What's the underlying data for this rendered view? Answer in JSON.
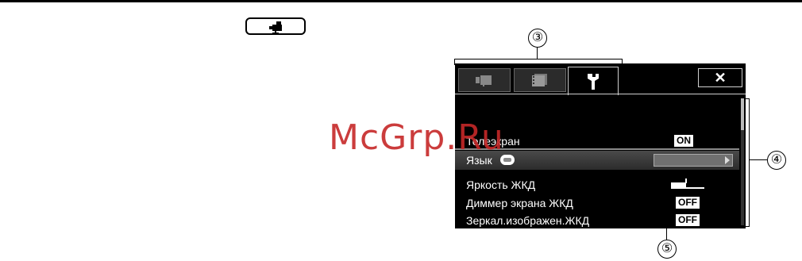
{
  "top_button": {
    "icon": "camera-mode-icon"
  },
  "watermark": "McGrp.Ru",
  "callouts": {
    "tabs": "③",
    "scrollbar": "④",
    "value": "⑤"
  },
  "screen": {
    "tabs": [
      {
        "icon": "movie-camera-icon"
      },
      {
        "icon": "film-playback-icon"
      },
      {
        "icon": "wrench-icon",
        "active": true
      }
    ],
    "close_label": "✕",
    "menu": [
      {
        "label": "Телеэкран",
        "value": "ON"
      },
      {
        "label": "Язык",
        "icon": "language-icon",
        "selected": true
      },
      {
        "label": "Яркость ЖКД",
        "level": 0.45
      },
      {
        "label": "Диммер экрана ЖКД",
        "value": "OFF"
      },
      {
        "label": "Зеркал.изображен.ЖКД",
        "value": "OFF"
      }
    ],
    "scroll_position": 0.0
  },
  "colors": {
    "screen_bg": "#000000",
    "watermark": "#c62828",
    "selected_row": "#3a3a3a"
  }
}
